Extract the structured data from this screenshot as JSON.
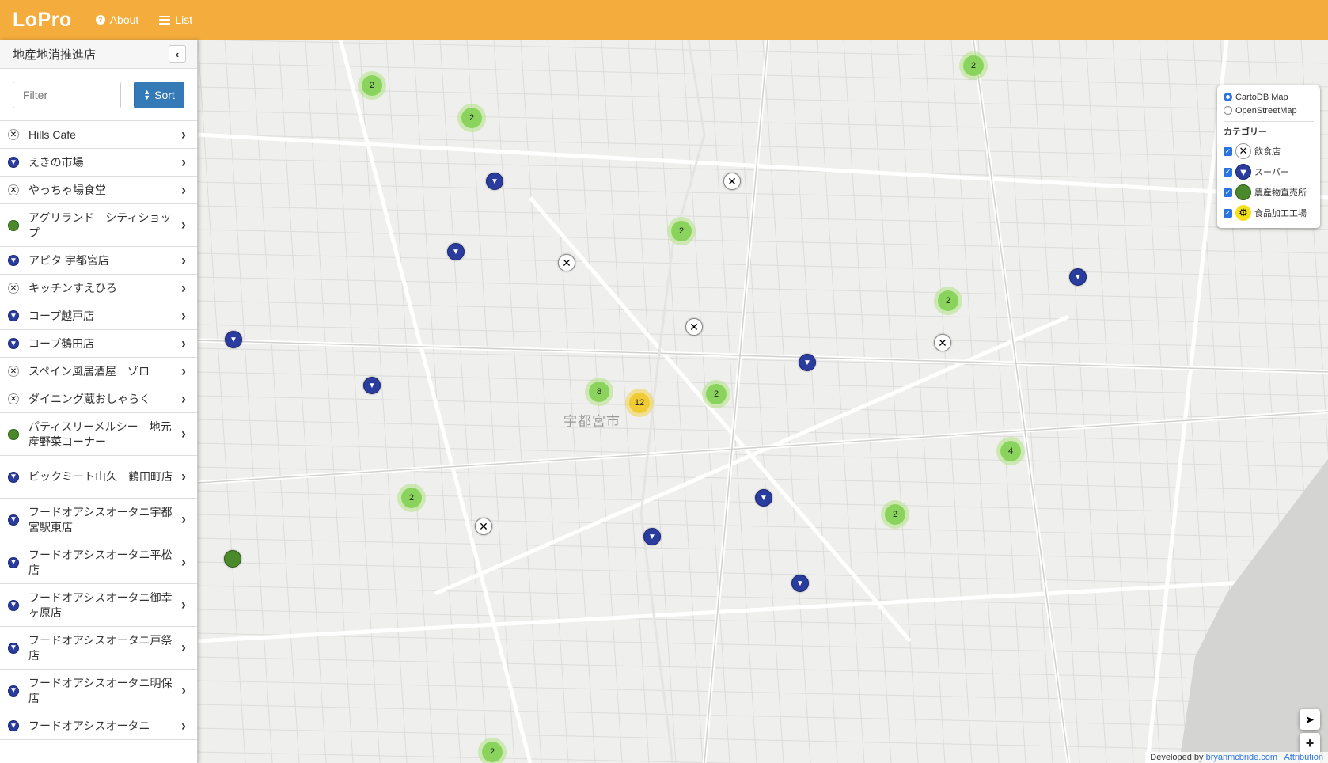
{
  "navbar": {
    "brand": "LoPro",
    "about": "About",
    "list": "List"
  },
  "sidebar": {
    "title": "地産地消推進店",
    "filter_placeholder": "Filter",
    "sort_label": "Sort",
    "items": [
      {
        "label": "Hills Cafe",
        "category": "rest"
      },
      {
        "label": "えきの市場",
        "category": "super"
      },
      {
        "label": "やっちゃ場食堂",
        "category": "rest"
      },
      {
        "label": "アグリランド　シティショップ",
        "category": "farm"
      },
      {
        "label": "アピタ 宇都宮店",
        "category": "super"
      },
      {
        "label": "キッチンすえひろ",
        "category": "rest"
      },
      {
        "label": "コープ越戸店",
        "category": "super"
      },
      {
        "label": "コープ鶴田店",
        "category": "super"
      },
      {
        "label": "スペイン風居酒屋　ゾロ",
        "category": "rest"
      },
      {
        "label": "ダイニング蔵おしゃらく",
        "category": "rest"
      },
      {
        "label": "パティスリーメルシー　地元産野菜コーナー",
        "category": "farm"
      },
      {
        "label": "ビックミート山久　鶴田町店",
        "category": "super"
      },
      {
        "label": "フードオアシスオータニ宇都宮駅東店",
        "category": "super"
      },
      {
        "label": "フードオアシスオータニ平松店",
        "category": "super"
      },
      {
        "label": "フードオアシスオータニ御幸ヶ原店",
        "category": "super"
      },
      {
        "label": "フードオアシスオータニ戸祭店",
        "category": "super"
      },
      {
        "label": "フードオアシスオータニ明保店",
        "category": "super"
      },
      {
        "label": "フードオアシスオータニ",
        "category": "super"
      }
    ]
  },
  "map": {
    "city_label": "宇都宮市",
    "clusters": [
      "2",
      "2",
      "2",
      "2",
      "2",
      "8",
      "12",
      "2",
      "4",
      "2",
      "2",
      "2"
    ]
  },
  "layers": {
    "base": [
      "CartoDB Map",
      "OpenStreetMap"
    ],
    "category_title": "カテゴリー",
    "categories": [
      "飲食店",
      "スーパー",
      "農産物直売所",
      "食品加工工場"
    ]
  },
  "attribution": {
    "prefix": "Developed by",
    "author": "bryanmcbride.com",
    "sep": "|",
    "link": "Attribution"
  },
  "icons": {
    "about": "question-circle-icon",
    "list": "list-icon",
    "locate": "location-arrow-icon"
  },
  "colors": {
    "navbar": "#f4ac3c",
    "primary": "#337ab7",
    "supermarket": "#2a3d9e",
    "farm": "#4a8a2a",
    "factory": "#f5e11a"
  }
}
